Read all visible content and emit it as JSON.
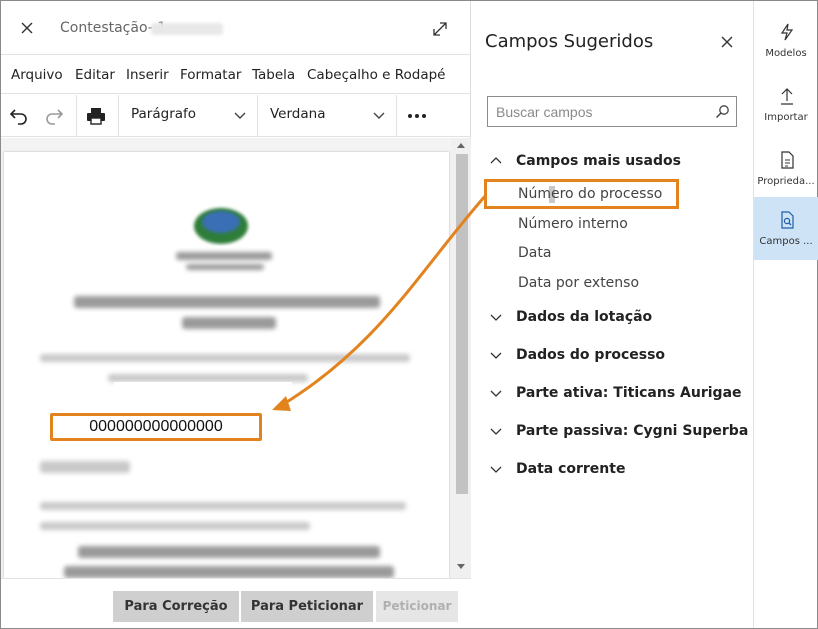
{
  "editor": {
    "title": "Contestação- 1",
    "menu": [
      "Arquivo",
      "Editar",
      "Inserir",
      "Formatar",
      "Tabela",
      "Cabeçalho e Rodapé"
    ],
    "paragraph_style": "Parágrafo",
    "font": "Verdana",
    "process_number": "000000000000000"
  },
  "footer": {
    "correcao": "Para Correção",
    "para_peticionar": "Para Peticionar",
    "peticionar": "Peticionar"
  },
  "panel": {
    "title": "Campos Sugeridos",
    "search_placeholder": "Buscar campos",
    "groups": [
      {
        "label": "Campos mais usados",
        "expanded": true,
        "items": [
          "Número do processo",
          "Número interno",
          "Data",
          "Data por extenso"
        ]
      },
      {
        "label": "Dados da lotação",
        "expanded": false
      },
      {
        "label": "Dados do processo",
        "expanded": false
      },
      {
        "label": "Parte ativa: Titicans Aurigae",
        "expanded": false
      },
      {
        "label": "Parte passiva: Cygni Superba",
        "expanded": false
      },
      {
        "label": "Data corrente",
        "expanded": false
      }
    ]
  },
  "sidebar": [
    {
      "label": "Modelos",
      "icon": "flash-icon",
      "active": false
    },
    {
      "label": "Importar",
      "icon": "upload-icon",
      "active": false
    },
    {
      "label": "Proprieda...",
      "icon": "properties-icon",
      "active": false
    },
    {
      "label": "Campos ...",
      "icon": "fields-search-icon",
      "active": true
    }
  ],
  "colors": {
    "highlight": "#e3831d",
    "active_tab": "#cfe3f7"
  }
}
